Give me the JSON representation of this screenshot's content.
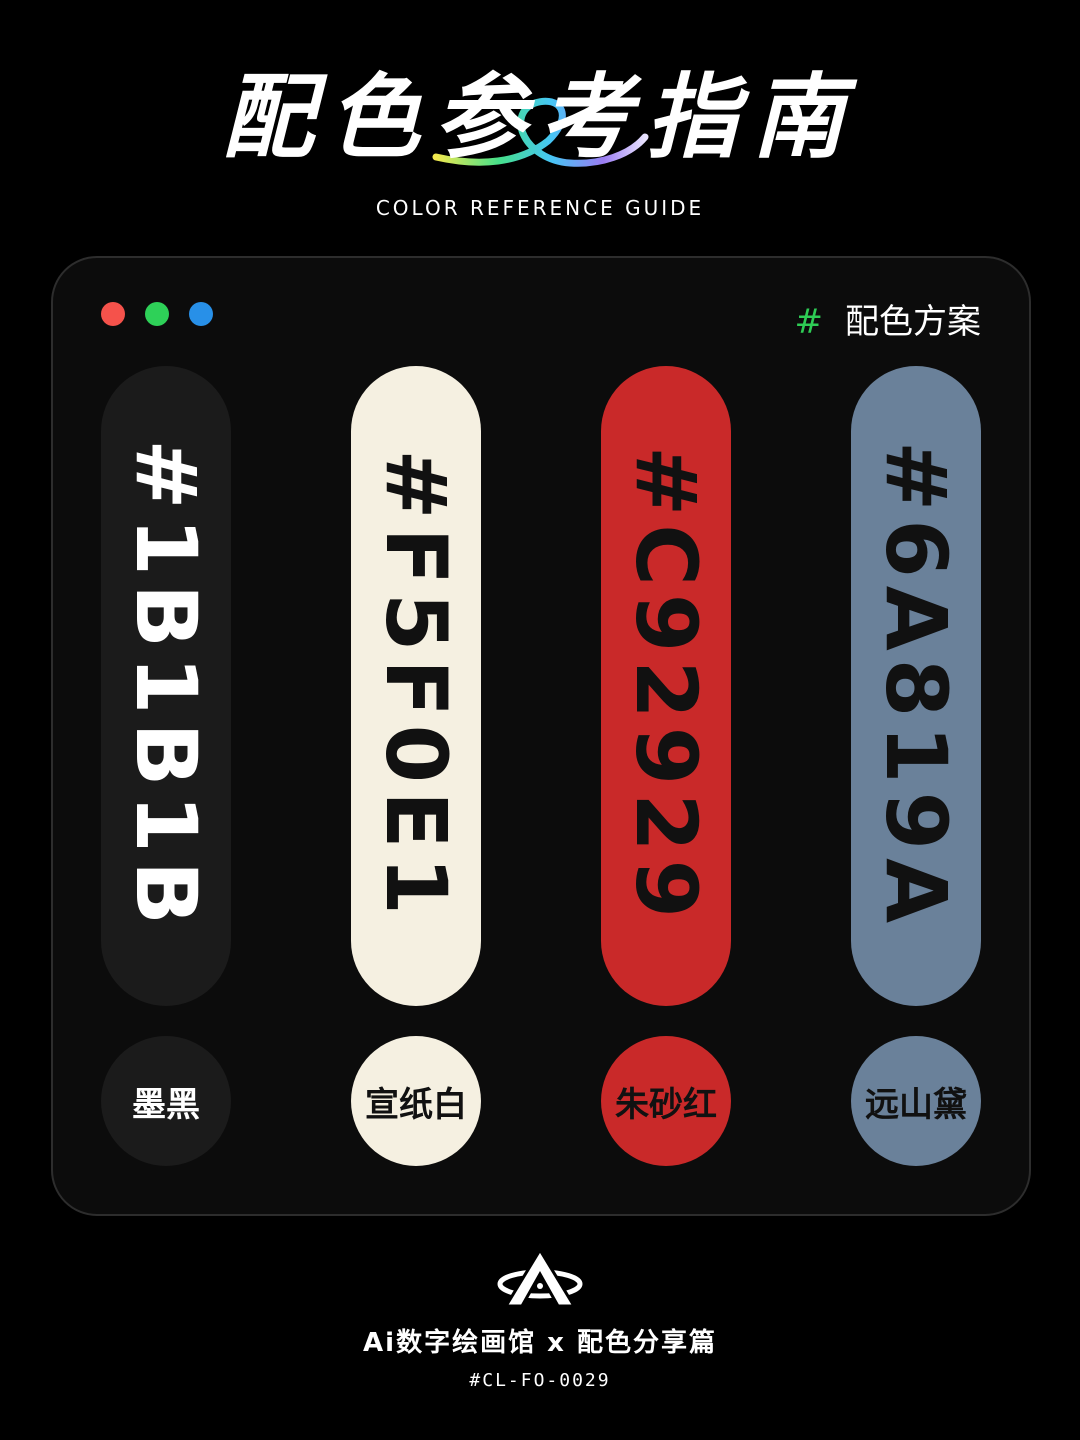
{
  "header": {
    "title": "配色参考指南",
    "subtitle": "COLOR REFERENCE GUIDE"
  },
  "window": {
    "dots": [
      {
        "name": "close-dot",
        "color": "#f5524b"
      },
      {
        "name": "minimize-dot",
        "color": "#2ed158"
      },
      {
        "name": "maximize-dot",
        "color": "#2890e8"
      }
    ],
    "label_hash": "#",
    "label_text": "配色方案",
    "hash_color": "#2ecc55"
  },
  "swatches": [
    {
      "hex": "#1B1B1B",
      "name": "墨黑",
      "bg": "#1b1b1b",
      "fg": "#ffffff"
    },
    {
      "hex": "#F5F0E1",
      "name": "宣纸白",
      "bg": "#f5f0e1",
      "fg": "#111111"
    },
    {
      "hex": "#C92929",
      "name": "朱砂红",
      "bg": "#c92929",
      "fg": "#111111"
    },
    {
      "hex": "#6A819A",
      "name": "远山黛",
      "bg": "#6a819a",
      "fg": "#111111"
    }
  ],
  "footer": {
    "brand": "Ai数字绘画馆 x 配色分享篇",
    "code": "#CL-FO-0029",
    "logo_icon": "a-monogram-logo"
  }
}
